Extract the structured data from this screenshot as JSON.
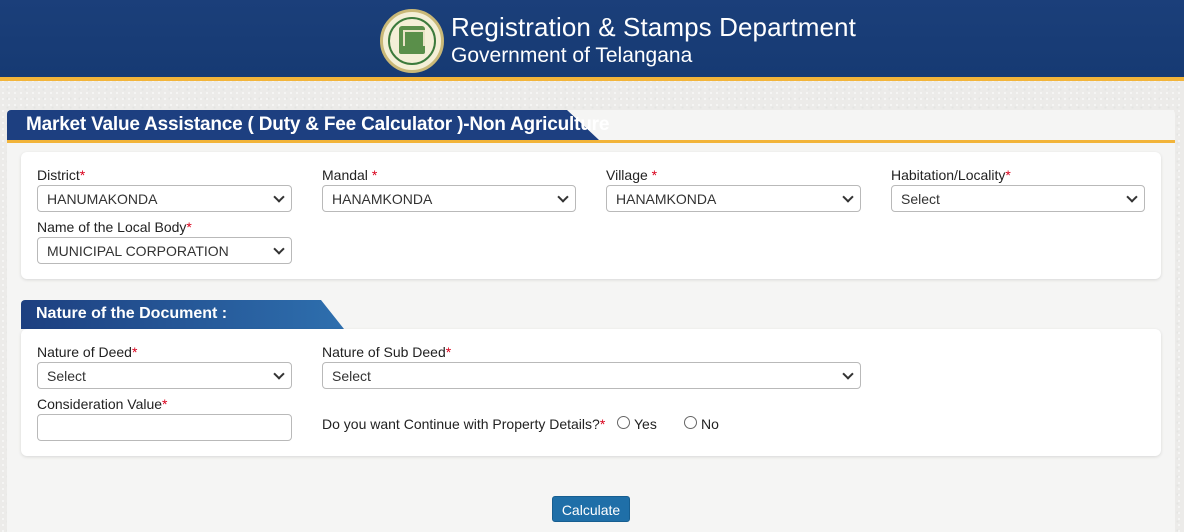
{
  "header": {
    "title": "Registration & Stamps Department",
    "subtitle": "Government of Telangana",
    "emblem_icon": "telangana-emblem-icon",
    "colors": {
      "banner": "#163a73",
      "accent": "#f2b43a"
    }
  },
  "panel": {
    "title": "Market Value Assistance ( Duty & Fee Calculator )-Non Agriculture"
  },
  "location": {
    "district": {
      "label": "District",
      "required": "*",
      "value": "HANUMAKONDA"
    },
    "mandal": {
      "label": "Mandal ",
      "required": "*",
      "value": "HANAMKONDA"
    },
    "village": {
      "label": "Village ",
      "required": "*",
      "value": "HANAMKONDA"
    },
    "habitation": {
      "label": "Habitation/Locality",
      "required": "*",
      "value": "Select"
    },
    "local_body": {
      "label": "Name of the Local Body",
      "required": "*",
      "value": "MUNICIPAL CORPORATION"
    }
  },
  "document": {
    "section_title": "Nature of the Document :",
    "nature_of_deed": {
      "label": "Nature of Deed",
      "required": "*",
      "value": "Select"
    },
    "nature_of_sub_deed": {
      "label": "Nature of Sub Deed",
      "required": "*",
      "value": "Select"
    },
    "consideration_value": {
      "label": "Consideration Value",
      "required": "*",
      "value": ""
    },
    "property_details": {
      "question": "Do you want Continue with Property Details?",
      "required": "*",
      "yes_label": "Yes",
      "no_label": "No"
    }
  },
  "actions": {
    "calculate_label": "Calculate"
  }
}
